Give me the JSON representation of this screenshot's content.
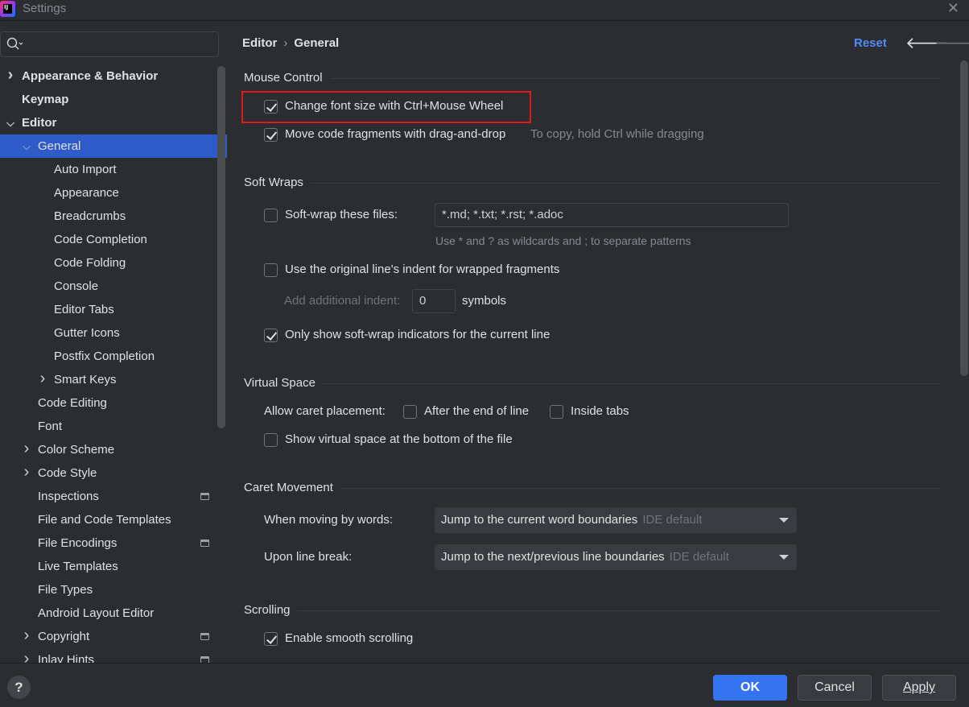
{
  "window": {
    "title": "Settings",
    "logo_text": "IJ"
  },
  "search": {
    "placeholder": "",
    "value": ""
  },
  "sidebar": {
    "items": [
      {
        "label": "Appearance & Behavior",
        "level": 0,
        "expander": "collapsed",
        "bold": true
      },
      {
        "label": "Keymap",
        "level": 0,
        "expander": "none",
        "bold": true
      },
      {
        "label": "Editor",
        "level": 0,
        "expander": "expanded",
        "bold": true
      },
      {
        "label": "General",
        "level": 1,
        "expander": "expanded",
        "selected": true
      },
      {
        "label": "Auto Import",
        "level": 2,
        "expander": "none"
      },
      {
        "label": "Appearance",
        "level": 2,
        "expander": "none"
      },
      {
        "label": "Breadcrumbs",
        "level": 2,
        "expander": "none"
      },
      {
        "label": "Code Completion",
        "level": 2,
        "expander": "none"
      },
      {
        "label": "Code Folding",
        "level": 2,
        "expander": "none"
      },
      {
        "label": "Console",
        "level": 2,
        "expander": "none"
      },
      {
        "label": "Editor Tabs",
        "level": 2,
        "expander": "none"
      },
      {
        "label": "Gutter Icons",
        "level": 2,
        "expander": "none"
      },
      {
        "label": "Postfix Completion",
        "level": 2,
        "expander": "none"
      },
      {
        "label": "Smart Keys",
        "level": 2,
        "expander": "collapsed"
      },
      {
        "label": "Code Editing",
        "level": 1,
        "expander": "none"
      },
      {
        "label": "Font",
        "level": 1,
        "expander": "none"
      },
      {
        "label": "Color Scheme",
        "level": 1,
        "expander": "collapsed"
      },
      {
        "label": "Code Style",
        "level": 1,
        "expander": "collapsed"
      },
      {
        "label": "Inspections",
        "level": 1,
        "expander": "none",
        "badge": true
      },
      {
        "label": "File and Code Templates",
        "level": 1,
        "expander": "none"
      },
      {
        "label": "File Encodings",
        "level": 1,
        "expander": "none",
        "badge": true
      },
      {
        "label": "Live Templates",
        "level": 1,
        "expander": "none"
      },
      {
        "label": "File Types",
        "level": 1,
        "expander": "none"
      },
      {
        "label": "Android Layout Editor",
        "level": 1,
        "expander": "none"
      },
      {
        "label": "Copyright",
        "level": 1,
        "expander": "collapsed",
        "badge": true
      },
      {
        "label": "Inlay Hints",
        "level": 1,
        "expander": "collapsed",
        "badge": true
      }
    ]
  },
  "header": {
    "breadcrumb_parent": "Editor",
    "breadcrumb_current": "General",
    "reset_label": "Reset"
  },
  "mouse_control": {
    "title": "Mouse Control",
    "ctrl_wheel_label": "Change font size with Ctrl+Mouse Wheel",
    "ctrl_wheel_checked": true,
    "drag_drop_label": "Move code fragments with drag-and-drop",
    "drag_drop_checked": true,
    "drag_drop_hint": "To copy, hold Ctrl while dragging"
  },
  "soft_wraps": {
    "title": "Soft Wraps",
    "wrap_files_label": "Soft-wrap these files:",
    "wrap_files_checked": false,
    "wrap_files_value": "*.md; *.txt; *.rst; *.adoc",
    "wrap_files_hint": "Use * and ? as wildcards and ; to separate patterns",
    "original_indent_label": "Use the original line's indent for wrapped fragments",
    "original_indent_checked": false,
    "additional_indent_label": "Add additional indent:",
    "additional_indent_value": "0",
    "additional_indent_unit": "symbols",
    "indicators_label": "Only show soft-wrap indicators for the current line",
    "indicators_checked": true
  },
  "virtual_space": {
    "title": "Virtual Space",
    "caret_label": "Allow caret placement:",
    "after_end_label": "After the end of line",
    "inside_tabs_label": "Inside tabs",
    "bottom_label": "Show virtual space at the bottom of the file"
  },
  "caret_movement": {
    "title": "Caret Movement",
    "words_label": "When moving by words:",
    "words_value": "Jump to the current word boundaries",
    "words_default": "IDE default",
    "line_break_label": "Upon line break:",
    "line_break_value": "Jump to the next/previous line boundaries",
    "line_break_default": "IDE default"
  },
  "scrolling": {
    "title": "Scrolling",
    "smooth_label": "Enable smooth scrolling",
    "smooth_checked": true
  },
  "footer": {
    "help_label": "?",
    "ok_label": "OK",
    "cancel_label": "Cancel",
    "apply_label": "Apply"
  },
  "colors": {
    "accent": "#3574f0",
    "link": "#548af7",
    "selection": "#2f5bc9",
    "highlight_box": "#e01b1b"
  }
}
